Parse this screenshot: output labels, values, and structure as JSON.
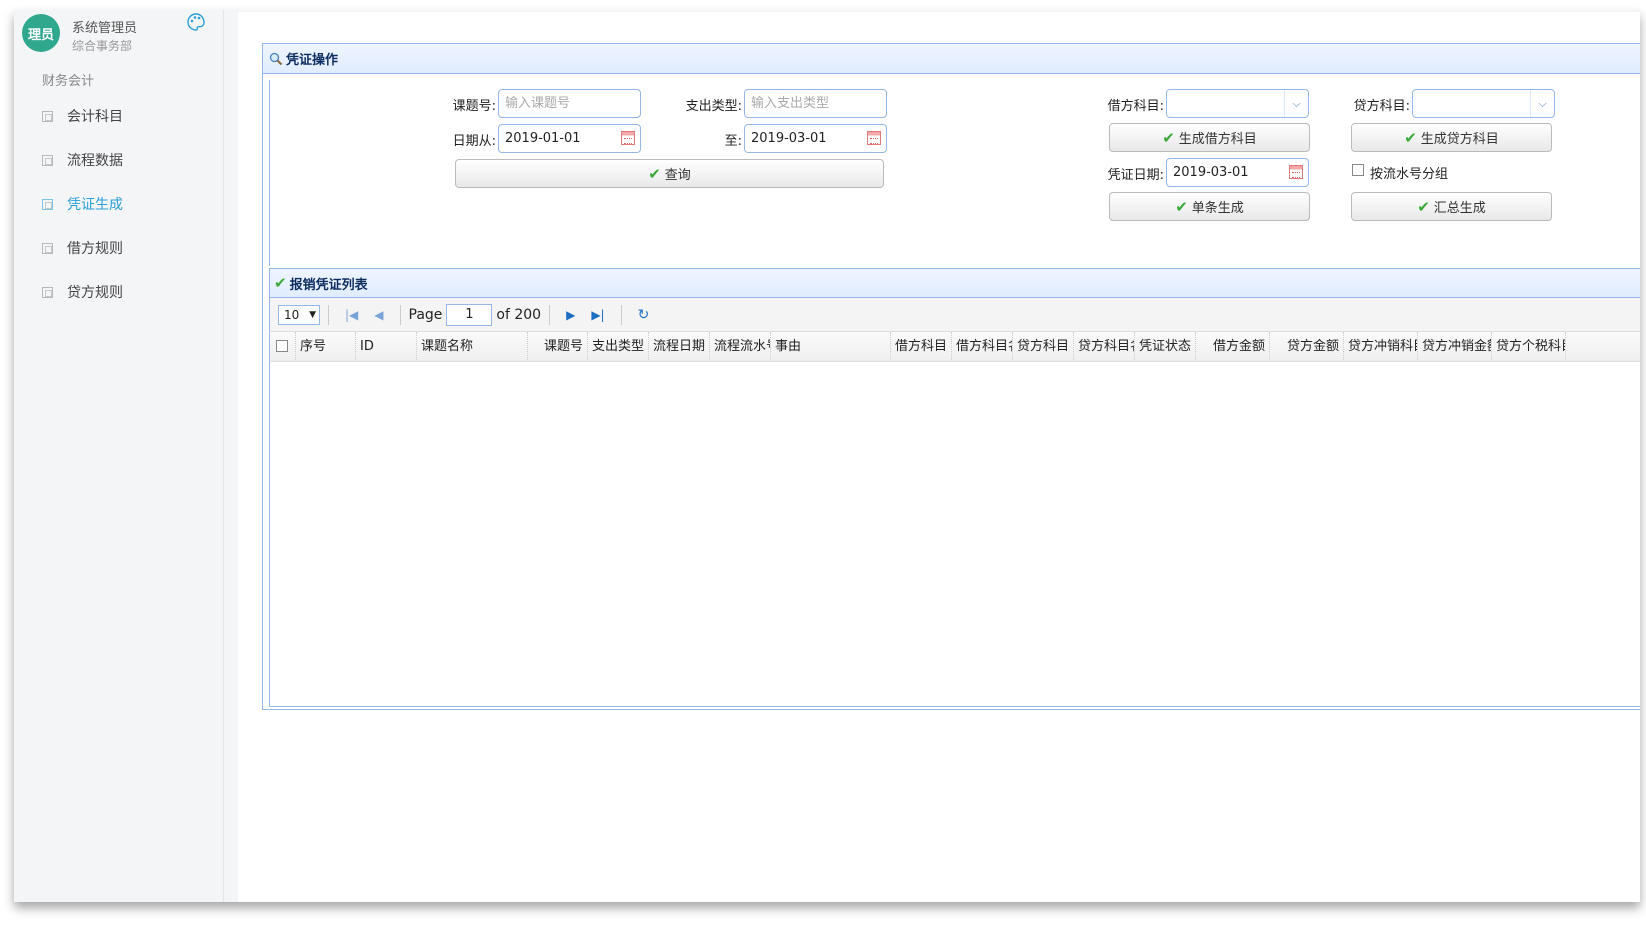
{
  "user": {
    "avatar_text": "理员",
    "name": "系统管理员",
    "dept": "综合事务部"
  },
  "sidebar": {
    "group_title": "财务会计",
    "items": [
      {
        "label": "会计科目"
      },
      {
        "label": "流程数据"
      },
      {
        "label": "凭证生成",
        "active": true
      },
      {
        "label": "借方规则"
      },
      {
        "label": "贷方规则"
      }
    ]
  },
  "voucher_panel": {
    "title": "凭证操作",
    "fields": {
      "topic_no": {
        "label": "课题号:",
        "placeholder": "输入课题号"
      },
      "expense_type": {
        "label": "支出类型:",
        "placeholder": "输入支出类型"
      },
      "date_from": {
        "label": "日期从:",
        "value": "2019-01-01"
      },
      "date_to": {
        "label": "至:",
        "value": "2019-03-01"
      },
      "debit_subject": {
        "label": "借方科目:",
        "value": ""
      },
      "credit_subject": {
        "label": "贷方科目:",
        "value": ""
      },
      "voucher_date": {
        "label": "凭证日期:",
        "value": "2019-03-01"
      }
    },
    "buttons": {
      "query": "查询",
      "gen_debit": "生成借方科目",
      "gen_credit": "生成贷方科目",
      "single_gen": "单条生成",
      "summary_gen": "汇总生成"
    },
    "group_by_serial_label": "按流水号分组"
  },
  "list_panel": {
    "title": "报销凭证列表",
    "pager": {
      "page_size": "10",
      "page_label": "Page",
      "current_page": "1",
      "total_label": "of 200"
    },
    "columns": [
      "序号",
      "ID",
      "课题名称",
      "课题号",
      "支出类型",
      "流程日期",
      "流程流水号",
      "事由",
      "借方科目",
      "借方科目名",
      "贷方科目",
      "贷方科目名",
      "凭证状态",
      "借方金额",
      "贷方金额",
      "贷方冲销科目",
      "贷方冲销金额",
      "贷方个税科目"
    ]
  }
}
